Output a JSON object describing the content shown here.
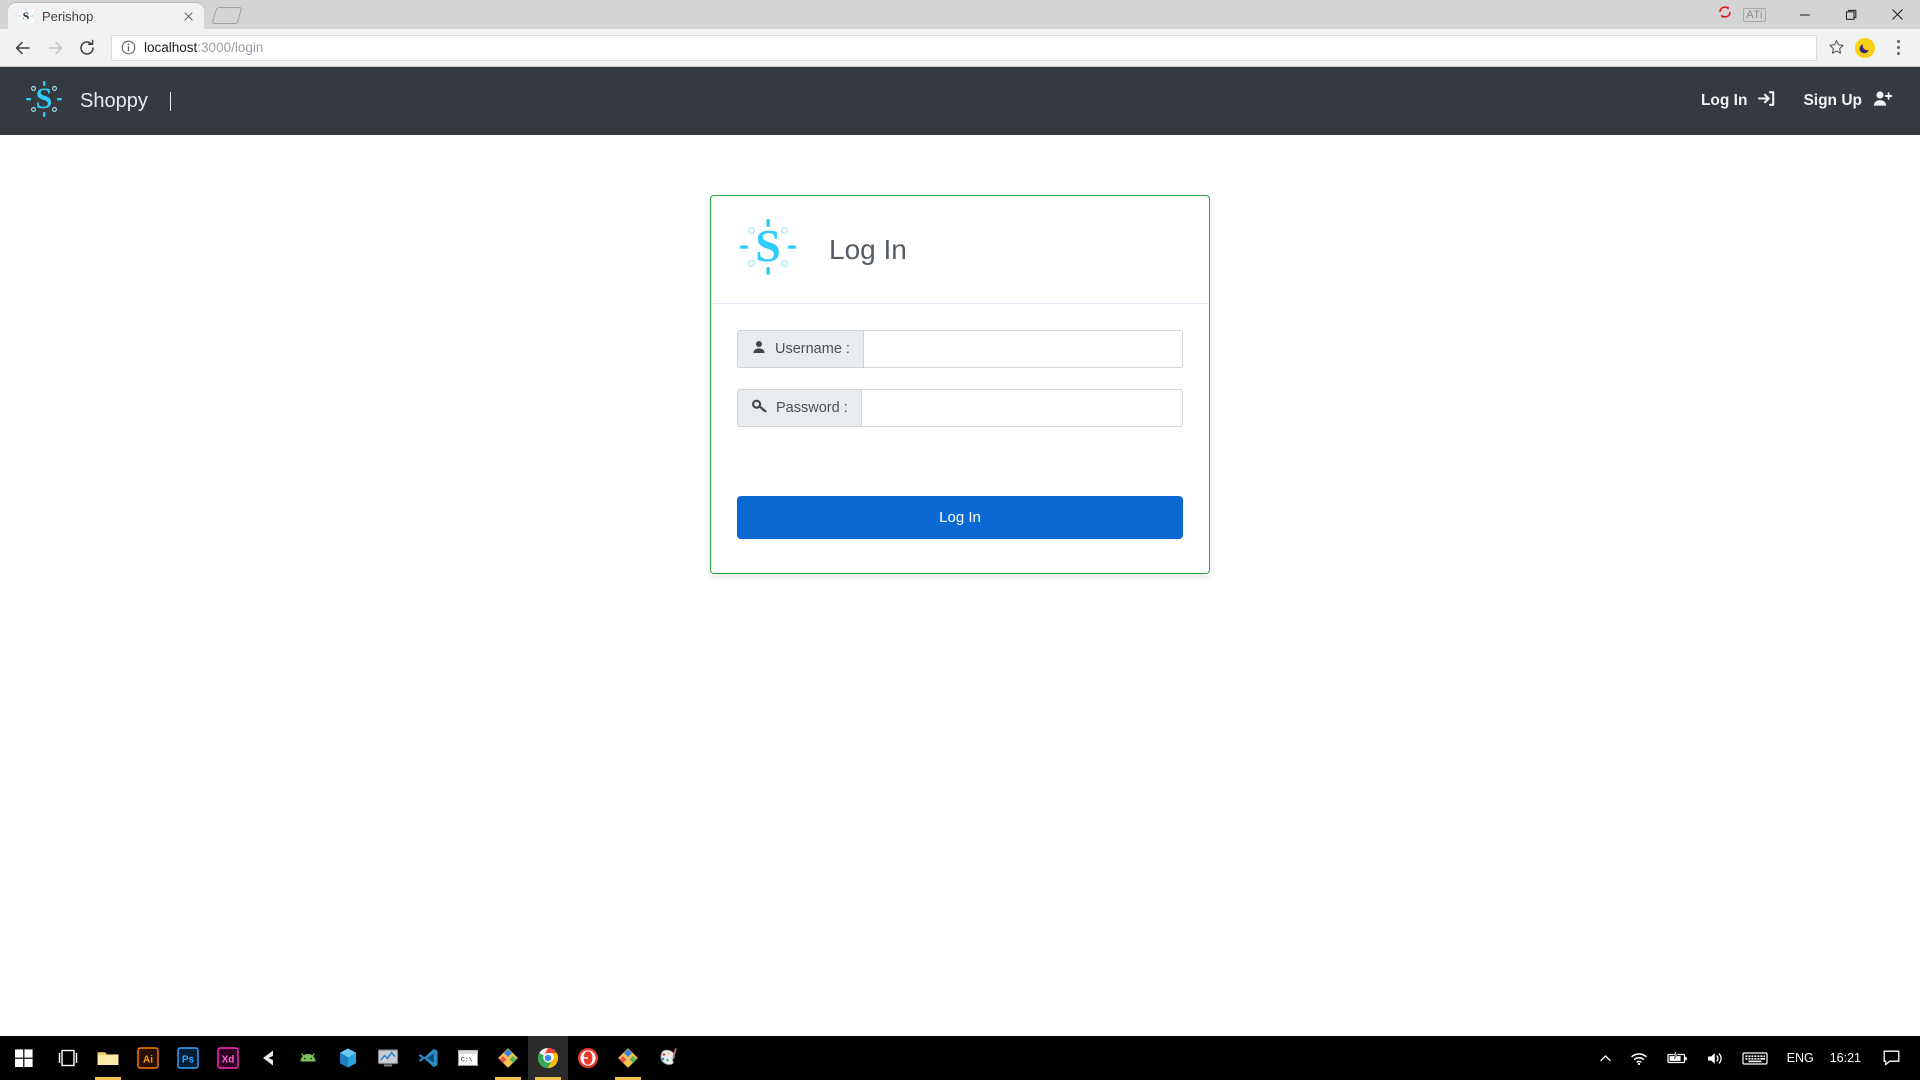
{
  "browser": {
    "tab": {
      "title": "Perishop",
      "favicon": "shoppy-s-favicon",
      "close_label": "Close tab"
    },
    "new_tab_label": "New Tab",
    "window_controls": {
      "update_icon": "sync-update-icon",
      "ati_badge": "ATi",
      "minimize": "Minimize",
      "maximize": "Maximize",
      "close": "Close"
    },
    "toolbar": {
      "back": "Back",
      "forward": "Forward",
      "reload": "Reload",
      "info_icon": "page-info-icon",
      "url_host": "localhost",
      "url_path": ":3000/login",
      "url_full": "localhost:3000/login",
      "bookmark": "Bookmark this page",
      "extension": "dark-mode-extension",
      "menu": "Customize and control Google Chrome"
    }
  },
  "navbar": {
    "logo": "shoppy-logo",
    "brand": "Shoppy",
    "links": [
      {
        "label": "Log In",
        "icon": "sign-in-icon"
      },
      {
        "label": "Sign Up",
        "icon": "user-plus-icon"
      }
    ]
  },
  "login_card": {
    "logo": "shoppy-logo-large",
    "title": "Log In",
    "fields": [
      {
        "name": "username",
        "label": "Username :",
        "icon": "user-icon",
        "value": "",
        "placeholder": ""
      },
      {
        "name": "password",
        "label": "Password :",
        "icon": "key-icon",
        "value": "",
        "placeholder": ""
      }
    ],
    "submit_label": "Log In",
    "colors": {
      "border": "#28a745",
      "submit_bg": "#0b69d4",
      "logo": "#2ecdfb"
    }
  },
  "taskbar": {
    "items": [
      {
        "name": "start-button",
        "icon": "windows-logo-icon",
        "running": false
      },
      {
        "name": "task-view-button",
        "icon": "task-view-icon",
        "running": false
      },
      {
        "name": "file-explorer",
        "icon": "folder-icon",
        "running": true
      },
      {
        "name": "adobe-illustrator",
        "icon": "illustrator-icon",
        "label": "Ai",
        "running": false
      },
      {
        "name": "adobe-photoshop",
        "icon": "photoshop-icon",
        "label": "Ps",
        "running": false
      },
      {
        "name": "adobe-xd",
        "icon": "adobe-xd-icon",
        "label": "Xd",
        "running": false
      },
      {
        "name": "unity-editor",
        "icon": "unity-icon",
        "running": false
      },
      {
        "name": "android-studio",
        "icon": "android-icon",
        "running": false
      },
      {
        "name": "blender",
        "icon": "cube-icon",
        "running": false
      },
      {
        "name": "task-manager",
        "icon": "monitor-chart-icon",
        "running": false
      },
      {
        "name": "visual-studio-code",
        "icon": "vscode-icon",
        "running": true
      },
      {
        "name": "command-prompt",
        "icon": "cmd-icon",
        "running": false
      },
      {
        "name": "diamond-app",
        "icon": "diamond-icon",
        "running": true
      },
      {
        "name": "google-chrome",
        "icon": "chrome-icon",
        "running": true
      },
      {
        "name": "opera-gx",
        "icon": "red-circle-icon",
        "running": false
      },
      {
        "name": "diamond-app-2",
        "icon": "diamond-icon",
        "running": true
      },
      {
        "name": "paint-app",
        "icon": "paint-palette-icon",
        "running": false
      }
    ],
    "tray": {
      "show_hidden": "show-hidden-icons",
      "network": "wifi-icon",
      "battery": "battery-charging-icon",
      "volume": "volume-icon",
      "keyboard": "keyboard-icon",
      "language": "ENG",
      "clock": "16:21",
      "notifications": "notification-icon"
    }
  }
}
